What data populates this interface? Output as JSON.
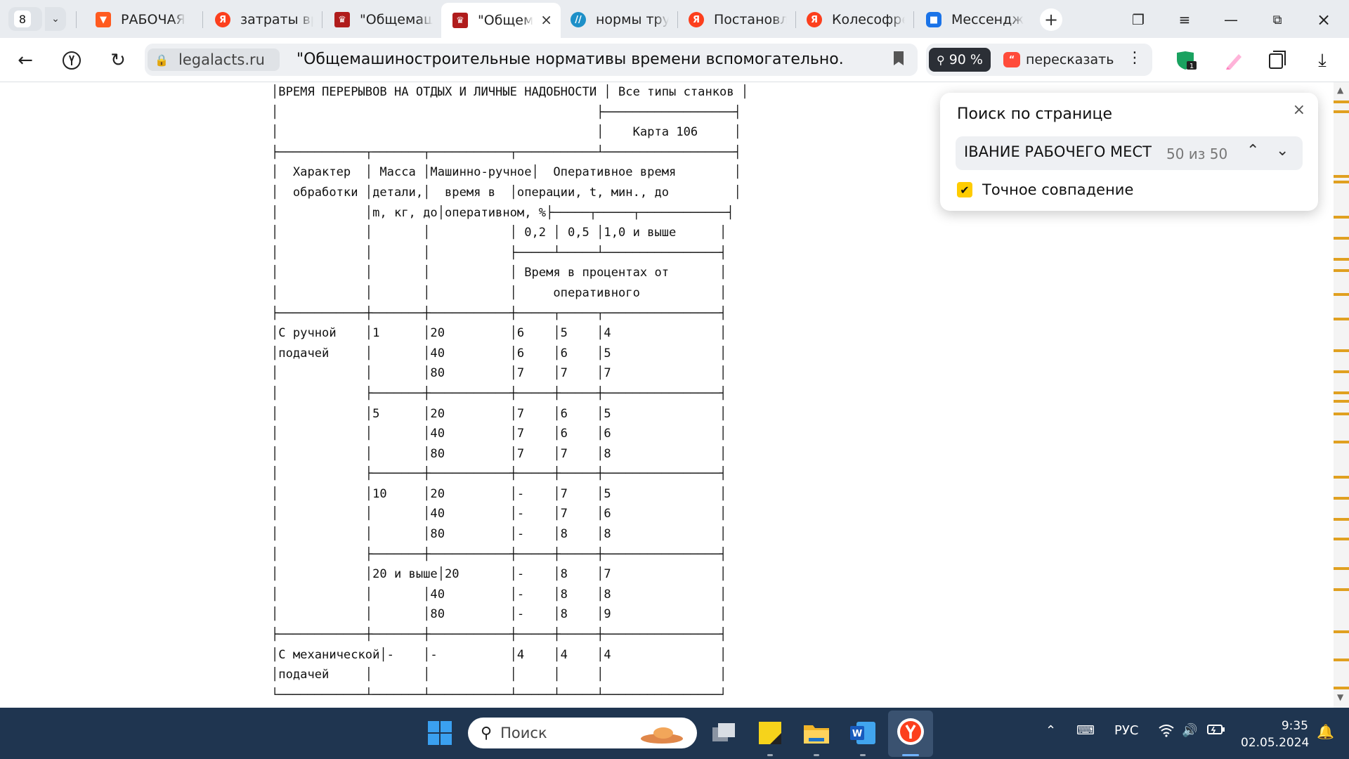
{
  "tabbar": {
    "tab_count": "8",
    "tabs": [
      {
        "title": "РАБОЧАЯ",
        "icon": "document-red-icon",
        "color": "#ff5a1f"
      },
      {
        "title": "затраты вр",
        "icon": "yandex-icon",
        "color": "#fc3f1d"
      },
      {
        "title": "\"Общемаш",
        "icon": "emblem-icon",
        "color": "#b01c1c"
      },
      {
        "title": "\"Общем",
        "icon": "emblem-icon",
        "color": "#b01c1c"
      },
      {
        "title": "нормы тру",
        "icon": "site-blue-icon",
        "color": "#1e90c8"
      },
      {
        "title": "Постановл",
        "icon": "yandex-icon",
        "color": "#fc3f1d"
      },
      {
        "title": "Колесофре",
        "icon": "yandex-icon",
        "color": "#fc3f1d"
      },
      {
        "title": "Мессендж",
        "icon": "messenger-icon",
        "color": "#1a73e8"
      }
    ]
  },
  "addressbar": {
    "domain": "legalacts.ru",
    "page_title": "\"Общемашиностроительные нормативы времени вспомогательно...",
    "zoom": "90 %",
    "retell_label": "пересказать"
  },
  "document": {
    "lines": [
      "│ВРЕМЯ ПЕРЕРЫВОВ НА ОТДЫХ И ЛИЧНЫЕ НАДОБНОСТИ │ Все типы станков │",
      "│                                            ├──────────────────┤",
      "│                                            │    Карта 106     │",
      "├────────────┬───────┬───────────┬───────────┴──────────────────┤",
      "│  Характер  │ Масса │Машинно-ручное│  Оперативное время        │",
      "│  обработки │детали,│  время в  │операции, t, мин., до         │",
      "│            │m, кг, до│оперативном, %├─────┬─────┬────────────┤",
      "│            │       │           │ 0,2 │ 0,5 │1,0 и выше      │",
      "│            │       │           ├─────┴─────┴────────────────┤",
      "│            │       │           │ Время в процентах от       │",
      "│            │       │           │     оперативного           │",
      "├────────────┼───────┼───────────┼─────┬─────┬────────────────┤",
      "│С ручной    │1      │20         │6    │5    │4               │",
      "│подачей     │       │40         │6    │6    │5               │",
      "│            │       │80         │7    │7    │7               │",
      "│            ├───────┼───────────┼─────┼─────┼────────────────┤",
      "│            │5      │20         │7    │6    │5               │",
      "│            │       │40         │7    │6    │6               │",
      "│            │       │80         │7    │7    │8               │",
      "│            ├───────┼───────────┼─────┼─────┼────────────────┤",
      "│            │10     │20         │-    │7    │5               │",
      "│            │       │40         │-    │7    │6               │",
      "│            │       │80         │-    │8    │8               │",
      "│            ├───────┼───────────┼─────┼─────┼────────────────┤",
      "│            │20 и выше│20       │-    │8    │7               │",
      "│            │       │40         │-    │8    │8               │",
      "│            │       │80         │-    │8    │9               │",
      "├────────────┼───────┼───────────┼─────┼─────┼────────────────┤",
      "│С механической│-    │-          │4    │4    │4               │",
      "│подачей     │       │           │     │     │                │",
      "└────────────┴───────┴───────────┴─────┴─────┴────────────────┘"
    ]
  },
  "findpanel": {
    "title": "Поиск по странице",
    "query": "ІВАНИЕ РАБОЧЕГО МЕСТ",
    "count": "50 из 50",
    "exact_label": "Точное совпадение",
    "exact_checked": true
  },
  "taskbar": {
    "search_placeholder": "Поиск",
    "language": "РУС",
    "time": "9:35",
    "date": "02.05.2024"
  },
  "colors": {
    "tabbar_bg": "#e9ecf0",
    "taskbar_bg": "#1f3550",
    "accent_yellow": "#ffcc00",
    "scroll_marks": "#e0a020"
  }
}
